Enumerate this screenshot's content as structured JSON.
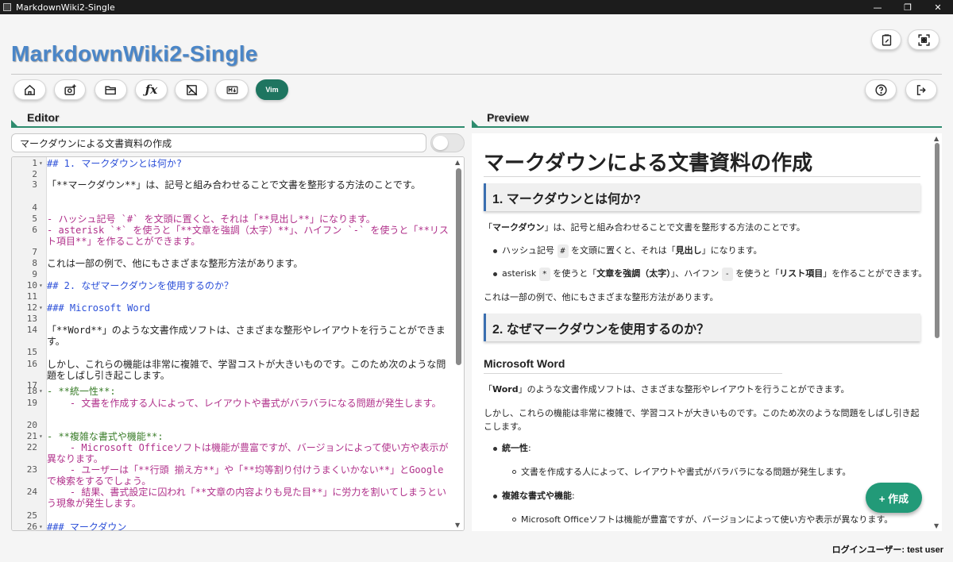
{
  "window": {
    "title": "MarkdownWiki2-Single",
    "controls": [
      "—",
      "❐",
      "✕"
    ]
  },
  "header": {
    "app_title": "MarkdownWiki2-Single",
    "toolbar_left": [
      {
        "name": "home-icon"
      },
      {
        "name": "camera-plus-icon"
      },
      {
        "name": "folder-open-icon"
      },
      {
        "name": "function-icon"
      },
      {
        "name": "image-off-icon"
      },
      {
        "name": "markdown-icon"
      }
    ],
    "vim_label": "Vim",
    "toolbar_right_top": [
      {
        "name": "edit-note-icon"
      },
      {
        "name": "qr-code-icon"
      }
    ],
    "toolbar_right": [
      {
        "name": "help-icon"
      },
      {
        "name": "logout-icon"
      }
    ]
  },
  "editor": {
    "section_label": "Editor",
    "doc_title": "マークダウンによる文書資料の作成",
    "lines": [
      {
        "n": "1",
        "fold": "▾",
        "text": "## 1. マークダウンとは何か?",
        "cls": "c-h"
      },
      {
        "n": "2",
        "fold": "",
        "text": "",
        "cls": "c-t"
      },
      {
        "n": "3",
        "fold": "",
        "text": "「**マークダウン**」は、記号と組み合わせることで文書を整形する方法のことです。",
        "cls": "c-t"
      },
      {
        "n": "4",
        "fold": "",
        "text": "",
        "cls": "c-t"
      },
      {
        "n": "5",
        "fold": "",
        "text": "- ハッシュ記号 `#` を文頭に置くと、それは「**見出し**」になります。",
        "cls": "c-l"
      },
      {
        "n": "6",
        "fold": "",
        "text": "- asterisk `*` を使うと「**文章を強調（太字）**」、ハイフン `-` を使うと「**リスト項目**」を作ることができます。",
        "cls": "c-l"
      },
      {
        "n": "7",
        "fold": "",
        "text": "",
        "cls": "c-t"
      },
      {
        "n": "8",
        "fold": "",
        "text": "これは一部の例で、他にもさまざまな整形方法があります。",
        "cls": "c-t"
      },
      {
        "n": "9",
        "fold": "",
        "text": "",
        "cls": "c-t"
      },
      {
        "n": "10",
        "fold": "▾",
        "text": "## 2. なぜマークダウンを使用するのか？",
        "cls": "c-h"
      },
      {
        "n": "11",
        "fold": "",
        "text": "",
        "cls": "c-t"
      },
      {
        "n": "12",
        "fold": "▾",
        "text": "### Microsoft Word",
        "cls": "c-h"
      },
      {
        "n": "13",
        "fold": "",
        "text": "",
        "cls": "c-t"
      },
      {
        "n": "14",
        "fold": "",
        "text": "「**Word**」のような文書作成ソフトは、さまざまな整形やレイアウトを行うことができます。",
        "cls": "c-t"
      },
      {
        "n": "15",
        "fold": "",
        "text": "",
        "cls": "c-t"
      },
      {
        "n": "16",
        "fold": "",
        "text": "しかし、これらの機能は非常に複雑で、学習コストが大きいものです。このため次のような問題をしばし引き起こします。",
        "cls": "c-t"
      },
      {
        "n": "17",
        "fold": "",
        "text": "",
        "cls": "c-t"
      },
      {
        "n": "18",
        "fold": "▾",
        "text": "- **統一性**:",
        "cls": "c-b"
      },
      {
        "n": "19",
        "fold": "",
        "text": "    - 文書を作成する人によって、レイアウトや書式がバラバラになる問題が発生します。",
        "cls": "c-l"
      },
      {
        "n": "20",
        "fold": "",
        "text": "",
        "cls": "c-t"
      },
      {
        "n": "21",
        "fold": "▾",
        "text": "- **複雑な書式や機能**:",
        "cls": "c-b"
      },
      {
        "n": "22",
        "fold": "",
        "text": "    - Microsoft Officeソフトは機能が豊富ですが、バージョンによって使い方や表示が異なります。",
        "cls": "c-l"
      },
      {
        "n": "23",
        "fold": "",
        "text": "    - ユーザーは「**行頭 揃え方**」や「**均等割り付けうまくいかない**」とGoogleで検索をするでしょう。",
        "cls": "c-l"
      },
      {
        "n": "24",
        "fold": "",
        "text": "    - 結果、書式設定に囚われ「**文章の内容よりも見た目**」に労力を割いてしまうという現象が発生します。",
        "cls": "c-l"
      },
      {
        "n": "25",
        "fold": "",
        "text": "",
        "cls": "c-t"
      },
      {
        "n": "26",
        "fold": "▾",
        "text": "### マークダウン",
        "cls": "c-h"
      }
    ]
  },
  "preview": {
    "section_label": "Preview",
    "h1": "マークダウンによる文書資料の作成",
    "h2_1": "1. マークダウンとは何か?",
    "p1_pre": "「",
    "p1_bold": "マークダウン",
    "p1_post": "」は、記号と組み合わせることで文書を整形する方法のことです。",
    "li1_a": "ハッシュ記号",
    "li1_code": "#",
    "li1_b": "を文頭に置くと、それは「",
    "li1_bold": "見出し",
    "li1_c": "」になります。",
    "li2_a": "asterisk",
    "li2_code": "*",
    "li2_b": "を使うと「",
    "li2_bold1": "文章を強調（太字）",
    "li2_c": "」、ハイフン",
    "li2_code2": "-",
    "li2_d": "を使うと「",
    "li2_bold2": "リスト項目",
    "li2_e": "」を作ることができます。",
    "p2": "これは一部の例で、他にもさまざまな整形方法があります。",
    "h2_2": "2. なぜマークダウンを使用するのか？",
    "h3": "Microsoft Word",
    "p3_pre": "「",
    "p3_bold": "Word",
    "p3_post": "」のような文書作成ソフトは、さまざまな整形やレイアウトを行うことができます。",
    "p4": "しかし、これらの機能は非常に複雑で、学習コストが大きいものです。このため次のような問題をしばし引き起こします。",
    "li3_bold": "統一性",
    "li3_colon": ":",
    "li3_sub": "文書を作成する人によって、レイアウトや書式がバラバラになる問題が発生します。",
    "li4_bold": "複雑な書式や機能",
    "li4_colon": ":",
    "li4_sub": "Microsoft Officeソフトは機能が豊富ですが、バージョンによって使い方や表示が異なります。"
  },
  "fab_label": "+ 作成",
  "status": {
    "login_user": "ログインユーザー: test user"
  },
  "colors": {
    "accent": "#229a78",
    "title_blue": "#4a86c8",
    "heading_code": "#2b4fd8",
    "list_code": "#b0308a"
  }
}
